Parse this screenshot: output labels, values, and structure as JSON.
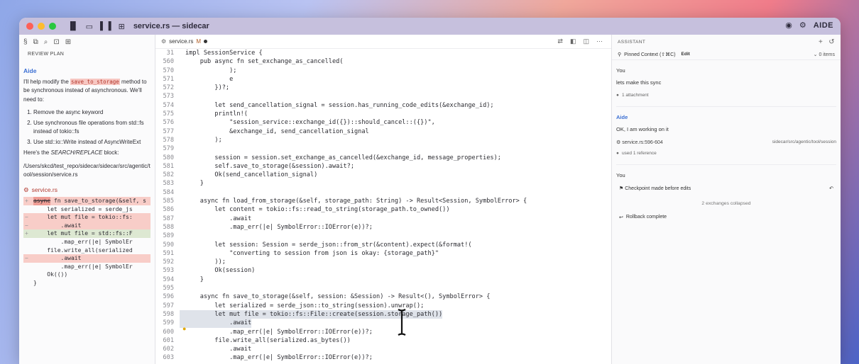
{
  "titlebar": {
    "title": "service.rs — sidecar",
    "brand": "AIDE"
  },
  "left_panel": {
    "header": "REVIEW PLAN",
    "aide_label": "Aide",
    "intro_pre": "I'll help modify the ",
    "intro_code": "save_to_storage",
    "intro_post": " method to be synchronous instead of asynchronous. We'll need to:",
    "steps": [
      "Remove the async keyword",
      "Use synchronous file operations from std::fs instead of tokio::fs",
      "Use std::io::Write instead of AsyncWriteExt"
    ],
    "block_text_pre": "Here's the ",
    "block_text_em": "SEARCH/REPLACE",
    "block_text_post": " block:",
    "path": "/Users/skcd/test_repo/sidecar/sidecar/src/agentic/tool/session/service.rs",
    "file": "service.rs",
    "diff": [
      {
        "gutter": "+",
        "kind": "del",
        "struck": "async",
        "rest": " fn save_to_storage(&self, s"
      },
      {
        "gutter": "",
        "kind": "",
        "struck": "",
        "rest": "    let serialized = serde_js"
      },
      {
        "gutter": "−",
        "kind": "del",
        "struck": "",
        "rest": "    let mut file = tokio::fs:"
      },
      {
        "gutter": "−",
        "kind": "del",
        "struck": "",
        "rest": "        .await"
      },
      {
        "gutter": "+",
        "kind": "add",
        "struck": "",
        "rest": "    let mut file = std::fs::F"
      },
      {
        "gutter": "",
        "kind": "",
        "struck": "",
        "rest": "        .map_err(|e| SymbolEr"
      },
      {
        "gutter": "",
        "kind": "",
        "struck": "",
        "rest": "    file.write_all(serialized"
      },
      {
        "gutter": "−",
        "kind": "del",
        "struck": "",
        "rest": "        .await"
      },
      {
        "gutter": "",
        "kind": "",
        "struck": "",
        "rest": "        .map_err(|e| SymbolEr"
      },
      {
        "gutter": "",
        "kind": "",
        "struck": "",
        "rest": "    Ok(())"
      },
      {
        "gutter": "",
        "kind": "",
        "struck": "",
        "rest": "}"
      }
    ]
  },
  "editor": {
    "tab_name": "service.rs",
    "tab_status": "M",
    "lines": [
      {
        "n": "31",
        "t": "impl SessionService {"
      },
      {
        "n": "560",
        "t": "    pub async fn set_exchange_as_cancelled("
      },
      {
        "n": "570",
        "t": "            );"
      },
      {
        "n": "571",
        "t": "            e"
      },
      {
        "n": "572",
        "t": "        })?;"
      },
      {
        "n": "573",
        "t": ""
      },
      {
        "n": "574",
        "t": "        let send_cancellation_signal = session.has_running_code_edits(&exchange_id);"
      },
      {
        "n": "575",
        "t": "        println!("
      },
      {
        "n": "576",
        "t": "            \"session_service::exchange_id({})::should_cancel::({})\","
      },
      {
        "n": "577",
        "t": "            &exchange_id, send_cancellation_signal"
      },
      {
        "n": "578",
        "t": "        );"
      },
      {
        "n": "579",
        "t": ""
      },
      {
        "n": "580",
        "t": "        session = session.set_exchange_as_cancelled(&exchange_id, message_properties);"
      },
      {
        "n": "581",
        "t": "        self.save_to_storage(&session).await?;"
      },
      {
        "n": "582",
        "t": "        Ok(send_cancellation_signal)"
      },
      {
        "n": "583",
        "t": "    }"
      },
      {
        "n": "584",
        "t": ""
      },
      {
        "n": "585",
        "t": "    async fn load_from_storage(&self, storage_path: String) -> Result<Session, SymbolError> {"
      },
      {
        "n": "586",
        "t": "        let content = tokio::fs::read_to_string(storage_path.to_owned())"
      },
      {
        "n": "587",
        "t": "            .await"
      },
      {
        "n": "588",
        "t": "            .map_err(|e| SymbolError::IOError(e))?;"
      },
      {
        "n": "589",
        "t": ""
      },
      {
        "n": "590",
        "t": "        let session: Session = serde_json::from_str(&content).expect(&format!("
      },
      {
        "n": "591",
        "t": "            \"converting to session from json is okay: {storage_path}\""
      },
      {
        "n": "592",
        "t": "        ));"
      },
      {
        "n": "593",
        "t": "        Ok(session)"
      },
      {
        "n": "594",
        "t": "    }"
      },
      {
        "n": "595",
        "t": ""
      },
      {
        "n": "596",
        "t": "    async fn save_to_storage(&self, session: &Session) -> Result<(), SymbolError> {"
      },
      {
        "n": "597",
        "t": "        let serialized = serde_json::to_string(session).unwrap();"
      },
      {
        "n": "598",
        "t": "        let mut file = tokio::fs::File::create(session.storage_path())"
      },
      {
        "n": "599",
        "t": "            .await"
      },
      {
        "n": "600",
        "t": "            .map_err(|e| SymbolError::IOError(e))?;"
      },
      {
        "n": "601",
        "t": "        file.write_all(serialized.as_bytes())"
      },
      {
        "n": "602",
        "t": "            .await"
      },
      {
        "n": "603",
        "t": "            .map_err(|e| SymbolError::IOError(e))?;"
      }
    ]
  },
  "assistant": {
    "header": "ASSISTANT",
    "pinned_label": "Pinned Context (⇧⌘C)",
    "edit_label": "Edit",
    "items_count": "0 items",
    "you_label_1": "You",
    "user_message": "lets make this sync",
    "attachment": "1 attachment",
    "aide_label": "Aide",
    "aide_message": "OK, I am working on it",
    "ref_file": "service.rs:596-604",
    "ref_path": "sidecar/src/agentic/tool/session",
    "used_ref": "used 1 reference",
    "you_label_2": "You",
    "checkpoint": "Checkpoint made before edits",
    "collapsed": "2 exchanges collapsed",
    "rollback": "Rollback complete"
  },
  "colors": {
    "accent": "#3b6fd3",
    "titlebar": "#c6c0dd",
    "deleted": "#f8cdc8",
    "added": "#dde8d2"
  }
}
